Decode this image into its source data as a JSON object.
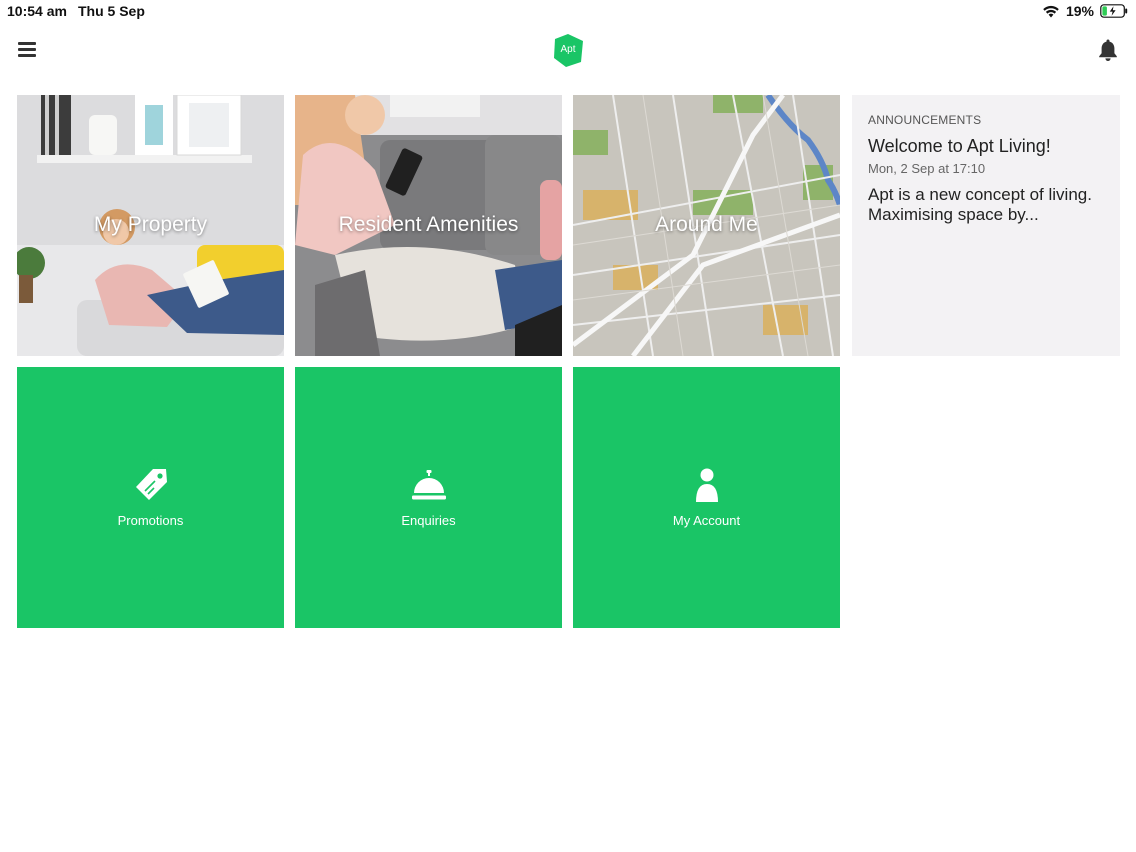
{
  "status_bar": {
    "time": "10:54 am",
    "date": "Thu 5 Sep",
    "battery": "19%",
    "icons": [
      "wifi-icon",
      "battery-charging-icon"
    ]
  },
  "header": {
    "logo_text": "Apt",
    "brand_color": "#1ac566",
    "icons": [
      "menu-icon",
      "bell-icon"
    ]
  },
  "tiles": {
    "my_property": {
      "label": "My Property"
    },
    "resident_amenities": {
      "label": "Resident Amenities"
    },
    "around_me": {
      "label": "Around Me"
    },
    "promotions": {
      "label": "Promotions",
      "icon": "price-tag-icon"
    },
    "enquiries": {
      "label": "Enquiries",
      "icon": "service-bell-icon"
    },
    "my_account": {
      "label": "My Account",
      "icon": "person-icon"
    }
  },
  "announcements": {
    "heading": "ANNOUNCEMENTS",
    "title": "Welcome to Apt Living!",
    "date": "Mon, 2 Sep at 17:10",
    "body": "Apt is a new concept of living. Maximising space by..."
  }
}
